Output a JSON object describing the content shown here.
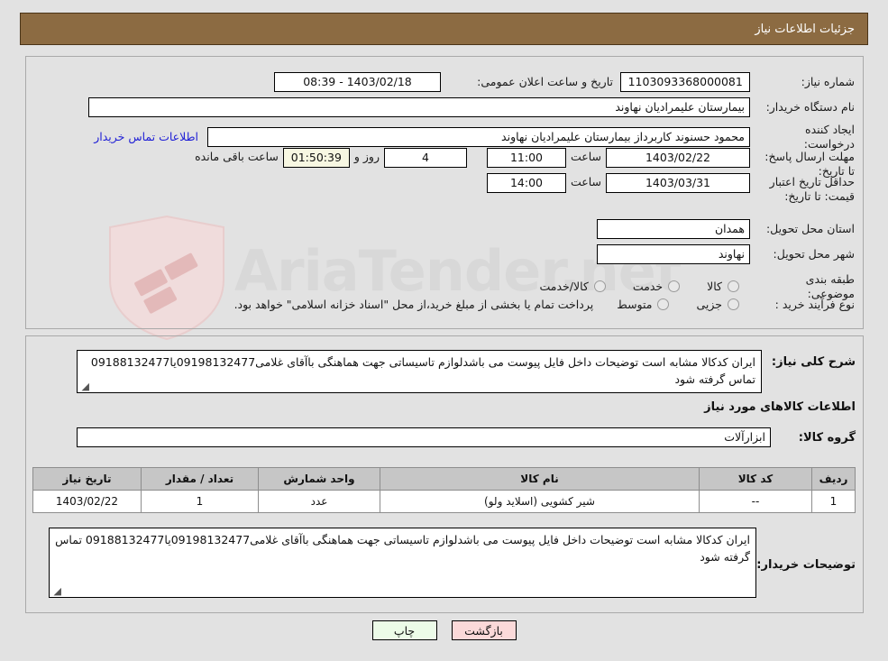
{
  "header": {
    "title": "جزئیات اطلاعات نیاز"
  },
  "form": {
    "need_number": {
      "label": "شماره نیاز:",
      "value": "1103093368000081"
    },
    "announce_datetime": {
      "label": "تاریخ و ساعت اعلان عمومی:",
      "value": "1403/02/18 - 08:39"
    },
    "buyer_org": {
      "label": "نام دستگاه خریدار:",
      "value": "بیمارستان علیمرادیان نهاوند"
    },
    "request_creator": {
      "label": "ایجاد کننده درخواست:",
      "value": "محمود حسنوند کاربرداز بیمارستان علیمرادیان نهاوند"
    },
    "buyer_contact_link": {
      "label": "اطلاعات تماس خریدار"
    },
    "reply_deadline": {
      "label": "مهلت ارسال پاسخ: تا تاریخ:",
      "date": "1403/02/22",
      "hour_label": "ساعت",
      "hour": "11:00",
      "days_remaining": "4",
      "day_and_label": "روز و",
      "time_remaining": "01:50:39",
      "remaining_suffix": "ساعت باقی مانده"
    },
    "price_validity": {
      "label": "حداقل تاریخ اعتبار قیمت: تا تاریخ:",
      "date": "1403/03/31",
      "hour_label": "ساعت",
      "hour": "14:00"
    },
    "delivery_province": {
      "label": "استان محل تحویل:",
      "value": "همدان"
    },
    "delivery_city": {
      "label": "شهر محل تحویل:",
      "value": "نهاوند"
    },
    "subject_category": {
      "label": "طبقه بندی موضوعی:",
      "options": [
        "کالا",
        "خدمت",
        "کالا/خدمت"
      ],
      "selected": ""
    },
    "purchase_process": {
      "label": "نوع فرآیند خرید :",
      "options": [
        "جزیی",
        "متوسط"
      ],
      "selected": "",
      "note": "پرداخت تمام یا بخشی از مبلغ خرید،از محل \"اسناد خزانه اسلامی\" خواهد بود."
    }
  },
  "summary": {
    "label": "شرح کلی نیاز:",
    "value": "ایران کدکالا مشابه است توضیحات داخل فایل پیوست می باشدلوازم تاسیساتی جهت هماهنگی باآقای غلامی09198132477یا09188132477 تماس گرفته شود"
  },
  "items_section": {
    "heading": "اطلاعات کالاهای مورد نیاز",
    "group_label": "گروه کالا:",
    "group_value": "ابزارآلات",
    "columns": [
      "ردیف",
      "کد کالا",
      "نام کالا",
      "واحد شمارش",
      "تعداد / مقدار",
      "تاریخ نیاز"
    ],
    "rows": [
      {
        "row": "1",
        "code": "--",
        "name": "شیر کشویی (اسلاید ولو)",
        "unit": "عدد",
        "qty": "1",
        "need_date": "1403/02/22"
      }
    ]
  },
  "buyer_notes": {
    "label": "توضیحات خریدار:",
    "value": "ایران کدکالا مشابه است توضیحات داخل فایل پیوست می باشدلوازم تاسیساتی جهت هماهنگی باآقای غلامی09198132477یا09188132477 تماس گرفته شود"
  },
  "buttons": {
    "print": "چاپ",
    "back": "بازگشت"
  },
  "watermark": {
    "text": "AriaTender.net"
  },
  "colors": {
    "header_bg": "#8c6b42",
    "page_bg": "#e2e2e2",
    "link": "#2121d6",
    "timer_bg": "#f7f7e2",
    "table_header_bg": "#c6c6c6",
    "btn_back_bg": "#fbd9d9",
    "btn_print_bg": "#ecfbe8"
  }
}
